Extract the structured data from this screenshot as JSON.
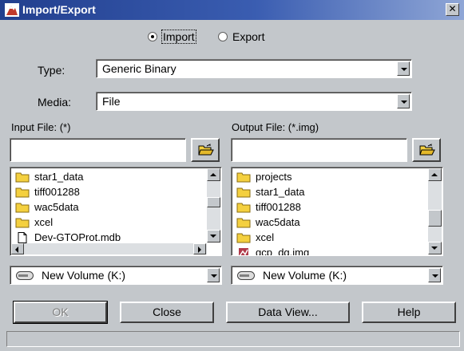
{
  "window": {
    "title": "Import/Export",
    "close_label": "✕"
  },
  "mode": {
    "import_label": "Import",
    "export_label": "Export",
    "selected": "import"
  },
  "type": {
    "label": "Type:",
    "value": "Generic Binary"
  },
  "media": {
    "label": "Media:",
    "value": "File"
  },
  "input": {
    "label": "Input File: (*)",
    "value": "",
    "files": [
      {
        "name": "star1_data",
        "icon": "folder-icon"
      },
      {
        "name": "tiff001288",
        "icon": "folder-icon"
      },
      {
        "name": "wac5data",
        "icon": "folder-icon"
      },
      {
        "name": "xcel",
        "icon": "folder-icon"
      },
      {
        "name": "Dev-GTOProt.mdb",
        "icon": "file-icon"
      }
    ],
    "volume": "New Volume (K:)"
  },
  "output": {
    "label": "Output File: (*.img)",
    "value": "",
    "files": [
      {
        "name": "projects",
        "icon": "folder-icon"
      },
      {
        "name": "star1_data",
        "icon": "folder-icon"
      },
      {
        "name": "tiff001288",
        "icon": "folder-icon"
      },
      {
        "name": "wac5data",
        "icon": "folder-icon"
      },
      {
        "name": "xcel",
        "icon": "folder-icon"
      },
      {
        "name": "gcp_dg.img",
        "icon": "image-file-icon"
      }
    ],
    "volume": "New Volume (K:)"
  },
  "buttons": {
    "ok": "OK",
    "close": "Close",
    "data_view": "Data View...",
    "help": "Help"
  },
  "status": "",
  "colors": {
    "title_bar_start": "#223f8e",
    "title_bar_end": "#8fa6d6",
    "face": "#c3c7cb",
    "folder": "#f4d03f"
  }
}
